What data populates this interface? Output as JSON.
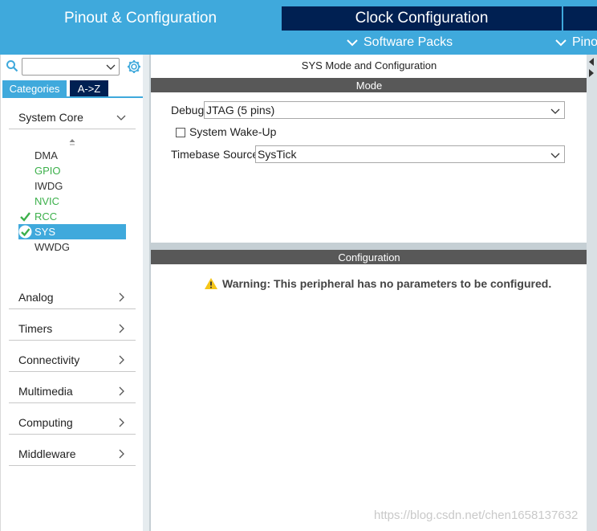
{
  "tabs": {
    "pinout": "Pinout & Configuration",
    "clock": "Clock Configuration"
  },
  "subbar": {
    "software_packs": "Software Packs",
    "pinout": "Pinou"
  },
  "left": {
    "category_tab": "Categories",
    "az_tab": "A->Z",
    "system_core": "System Core",
    "peripherals": [
      {
        "label": "DMA",
        "state": "normal"
      },
      {
        "label": "GPIO",
        "state": "green"
      },
      {
        "label": "IWDG",
        "state": "normal"
      },
      {
        "label": "NVIC",
        "state": "green"
      },
      {
        "label": "RCC",
        "state": "checked"
      },
      {
        "label": "SYS",
        "state": "selected"
      },
      {
        "label": "WWDG",
        "state": "normal"
      }
    ],
    "groups": [
      "Analog",
      "Timers",
      "Connectivity",
      "Multimedia",
      "Computing",
      "Middleware"
    ]
  },
  "main": {
    "title": "SYS Mode and Configuration",
    "mode_header": "Mode",
    "debug_label": "Debug",
    "debug_value": "JTAG (5 pins)",
    "wakeup_label": "System Wake-Up",
    "timebase_label": "Timebase Source",
    "timebase_value": "SysTick",
    "config_header": "Configuration",
    "warning": "Warning: This peripheral has no parameters to be configured."
  },
  "watermark": "https://blog.csdn.net/chen1658137632",
  "colors": {
    "accent": "#3fa9dc",
    "dark_navy": "#002052",
    "green": "#3cb04b",
    "section_bar": "#585858",
    "warning": "#f5c518"
  }
}
